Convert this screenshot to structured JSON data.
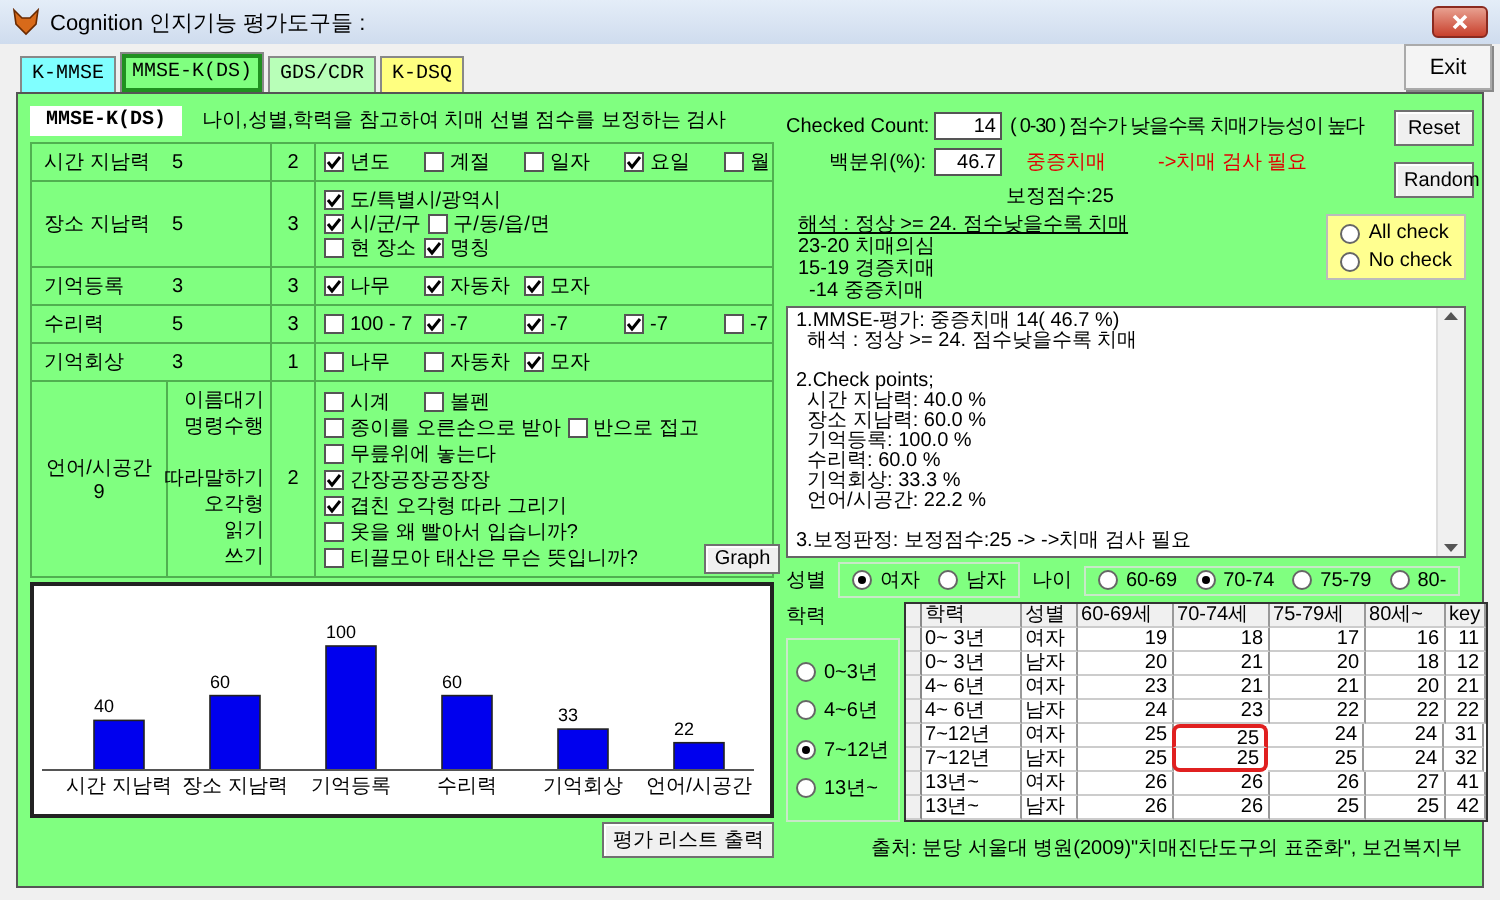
{
  "window": {
    "title": "Cognition 인지기능 평가도구들 :"
  },
  "tabs": [
    {
      "label": "K-MMSE",
      "selected": false,
      "color": "#80ffff"
    },
    {
      "label": "MMSE-K(DS)",
      "selected": true,
      "color": "#80ff80"
    },
    {
      "label": "GDS/CDR",
      "selected": false,
      "color": "#b8ffb8"
    },
    {
      "label": "K-DSQ",
      "selected": false,
      "color": "#ffff80"
    }
  ],
  "exit_button": "Exit",
  "test": {
    "title": "MMSE-K(DS)",
    "description": "나이,성별,학력을 참고하여 치매 선별 점수를 보정하는 검사",
    "sections": [
      {
        "kind": "plain",
        "name": "시간 지남력",
        "max": "5",
        "score": "2",
        "lines": [
          [
            {
              "label": "년도",
              "checked": true
            },
            {
              "label": "계절",
              "checked": false
            },
            {
              "label": "일자",
              "checked": false
            },
            {
              "label": "요일",
              "checked": true
            },
            {
              "label": "월",
              "checked": false
            }
          ]
        ]
      },
      {
        "kind": "plain",
        "name": "장소 지남력",
        "max": "5",
        "score": "3",
        "lines": [
          [
            {
              "label": "도/특별시/광역시",
              "checked": true
            }
          ],
          [
            {
              "label": "시/군/구",
              "checked": true
            },
            {
              "label": "구/동/읍/면",
              "checked": false
            }
          ],
          [
            {
              "label": "현 장소",
              "checked": false
            },
            {
              "label": "명칭",
              "checked": true
            }
          ]
        ]
      },
      {
        "kind": "plain",
        "name": "기억등록",
        "max": "3",
        "score": "3",
        "lines": [
          [
            {
              "label": "나무",
              "checked": true
            },
            {
              "label": "자동차",
              "checked": true
            },
            {
              "label": "모자",
              "checked": true
            }
          ]
        ]
      },
      {
        "kind": "plain",
        "name": "수리력",
        "max": "5",
        "score": "3",
        "lines": [
          [
            {
              "label": "100 - 7",
              "checked": false
            },
            {
              "label": "-7",
              "checked": true
            },
            {
              "label": "-7",
              "checked": true
            },
            {
              "label": "-7",
              "checked": true
            },
            {
              "label": "-7",
              "checked": false
            }
          ]
        ]
      },
      {
        "kind": "plain",
        "name": "기억회상",
        "max": "3",
        "score": "1",
        "lines": [
          [
            {
              "label": "나무",
              "checked": false
            },
            {
              "label": "자동차",
              "checked": false
            },
            {
              "label": "모자",
              "checked": true
            }
          ]
        ]
      },
      {
        "kind": "subtasks",
        "name": "언어/시공간",
        "max": "9",
        "score": "2",
        "subrows": [
          {
            "label": "이름대기",
            "items": [
              {
                "label": "시계",
                "checked": false
              },
              {
                "label": "볼펜",
                "checked": false
              }
            ]
          },
          {
            "label": "명령수행",
            "items": [
              {
                "label": "종이를 오른손으로 받아",
                "checked": false
              },
              {
                "label": "반으로 접고",
                "checked": false
              }
            ]
          },
          {
            "items": [
              {
                "label": "무릎위에 놓는다",
                "checked": false
              }
            ]
          },
          {
            "label": "따라말하기",
            "items": [
              {
                "label": "간장공장공장장",
                "checked": true
              }
            ]
          },
          {
            "label": "오각형",
            "items": [
              {
                "label": "겹친 오각형 따라 그리기",
                "checked": true
              }
            ]
          },
          {
            "label": "읽기",
            "items": [
              {
                "label": "옷을 왜 빨아서 입습니까?",
                "checked": false
              }
            ]
          },
          {
            "label": "쓰기",
            "items": [
              {
                "label": "티끌모아 태산은 무슨 뜻입니까?",
                "checked": false
              }
            ]
          }
        ]
      }
    ]
  },
  "graph_button": "Graph",
  "chart": {
    "chart_data": {
      "type": "bar",
      "categories": [
        "시간 지남력",
        "장소 지남력",
        "기억등록",
        "수리력",
        "기억회상",
        "언어/시공간"
      ],
      "values": [
        40,
        60,
        100,
        60,
        33,
        22
      ],
      "data_labels": true
    }
  },
  "print_button": "평가 리스트 출력",
  "result": {
    "count_label": "Checked Count:",
    "count_value": "14",
    "count_note": "( 0-30 ) 점수가 낮을수록 치매가능성이 높다",
    "percent_label": "백분위(%):",
    "percent_value": "46.7",
    "grade": "중증치매",
    "advice": "->치매 검사 필요",
    "corrected": "보정점수:25"
  },
  "buttons": [
    "Reset",
    "Random"
  ],
  "check_options": [
    {
      "label": "All check",
      "selected": false
    },
    {
      "label": "No check",
      "selected": false
    }
  ],
  "interpretation": {
    "heading": "해석 : 정상 >= 24. 점수낮을수록 치매",
    "lines": [
      "23-20 치매의심",
      "15-19 경증치매",
      "  -14 중증치매"
    ]
  },
  "report": {
    "paragraphs": [
      "1.MMSE-평가: 중증치매 14( 46.7 %)\n  해석 : 정상 >= 24. 점수낮을수록 치매",
      "2.Check points;\n  시간 지남력: 40.0 %\n  장소 지남력: 60.0 %\n  기억등록: 100.0 %\n  수리력: 60.0 %\n  기억회상: 33.3 %\n  언어/시공간: 22.2 %",
      "3.보정판정: 보정점수:25 -> ->치매 검사 필요"
    ]
  },
  "sex": {
    "label": "성별",
    "options": [
      {
        "label": "여자",
        "selected": true
      },
      {
        "label": "남자",
        "selected": false
      }
    ]
  },
  "age": {
    "label": "나이",
    "options": [
      {
        "label": "60-69",
        "selected": false
      },
      {
        "label": "70-74",
        "selected": true
      },
      {
        "label": "75-79",
        "selected": false
      },
      {
        "label": "80-",
        "selected": false
      }
    ]
  },
  "education": {
    "label": "학력",
    "options": [
      {
        "label": "0~3년",
        "selected": false
      },
      {
        "label": "4~6년",
        "selected": false
      },
      {
        "label": "7~12년",
        "selected": true
      },
      {
        "label": "13년~",
        "selected": false
      }
    ]
  },
  "norm_table": {
    "columns": [
      "학력",
      "성별",
      "60-69세",
      "70-74세",
      "75-79세",
      "80세~",
      "key"
    ],
    "rows": [
      {
        "cells": [
          "0~ 3년",
          "여자",
          "19",
          "18",
          "17",
          "16",
          "11"
        ],
        "circled": [
          false,
          false,
          false,
          false,
          false,
          false,
          false
        ]
      },
      {
        "cells": [
          "0~ 3년",
          "남자",
          "20",
          "21",
          "20",
          "18",
          "12"
        ],
        "circled": [
          false,
          false,
          false,
          false,
          false,
          false,
          false
        ]
      },
      {
        "cells": [
          "4~ 6년",
          "여자",
          "23",
          "21",
          "21",
          "20",
          "21"
        ],
        "circled": [
          false,
          false,
          false,
          false,
          false,
          false,
          false
        ]
      },
      {
        "cells": [
          "4~ 6년",
          "남자",
          "24",
          "23",
          "22",
          "22",
          "22"
        ],
        "circled": [
          false,
          false,
          false,
          false,
          false,
          false,
          false
        ]
      },
      {
        "cells": [
          "7~12년",
          "여자",
          "25",
          "25",
          "24",
          "24",
          "31"
        ],
        "circled": [
          false,
          false,
          false,
          true,
          false,
          false,
          false
        ]
      },
      {
        "cells": [
          "7~12년",
          "남자",
          "25",
          "25",
          "25",
          "24",
          "32"
        ],
        "circled": [
          false,
          false,
          false,
          true,
          false,
          false,
          false
        ]
      },
      {
        "cells": [
          "13년~",
          "여자",
          "26",
          "26",
          "26",
          "27",
          "41"
        ],
        "circled": [
          false,
          false,
          false,
          false,
          false,
          false,
          false
        ]
      },
      {
        "cells": [
          "13년~",
          "남자",
          "26",
          "26",
          "25",
          "25",
          "42"
        ],
        "circled": [
          false,
          false,
          false,
          false,
          false,
          false,
          false
        ]
      }
    ]
  },
  "source": "출처: 분당 서울대 병원(2009)\"치매진단도구의 표준화\", 보건복지부"
}
